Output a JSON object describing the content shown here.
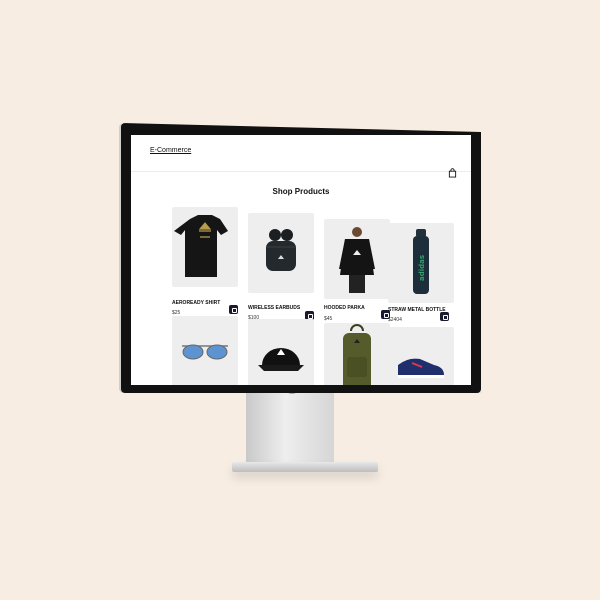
{
  "nav": {
    "brand": "E-Commerce",
    "cart_icon": "shopping-bag-icon"
  },
  "main": {
    "title": "Shop Products"
  },
  "products": [
    {
      "name": "AEROREADY SHIRT",
      "price": "$25",
      "image": "black-tshirt",
      "button_icon": "bag-add-icon"
    },
    {
      "name": "WIRELESS EARBUDS",
      "price": "$100",
      "image": "earbuds",
      "button_icon": "bag-add-icon"
    },
    {
      "name": "HOODED PARKA",
      "price": "$45",
      "image": "parka",
      "button_icon": "bag-add-icon"
    },
    {
      "name": "STRAW METAL BOTTLE",
      "price": "$2404",
      "image": "bottle",
      "button_icon": "bag-add-icon"
    },
    {
      "name": "",
      "price": "",
      "image": "sunglasses"
    },
    {
      "name": "",
      "price": "",
      "image": "cap"
    },
    {
      "name": "",
      "price": "",
      "image": "backpack"
    },
    {
      "name": "",
      "price": "",
      "image": "sneaker"
    }
  ],
  "colors": {
    "background": "#f7ede3",
    "accent": "#1a1a2e"
  }
}
